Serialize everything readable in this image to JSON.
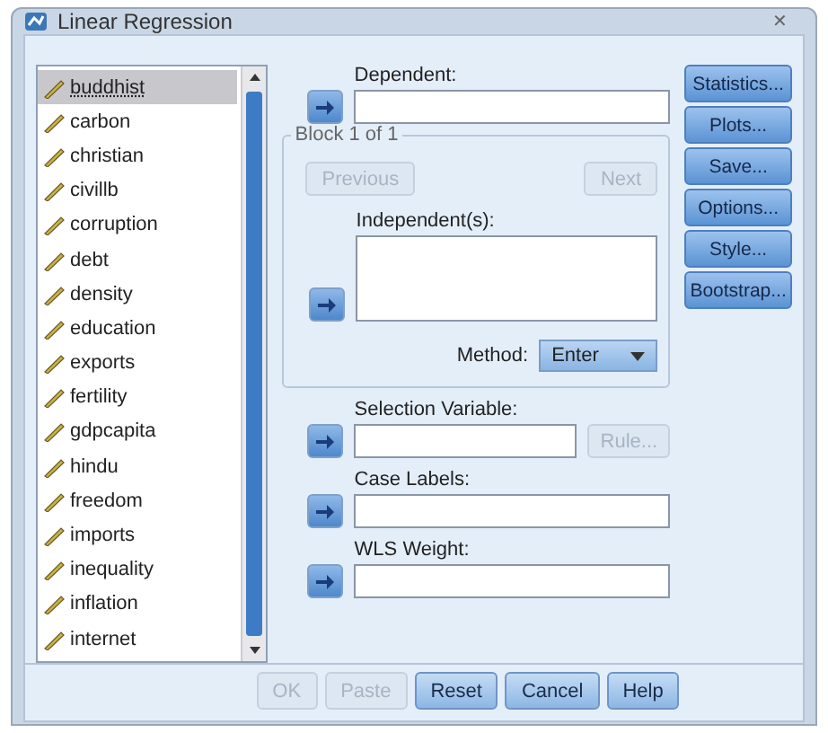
{
  "window": {
    "title": "Linear Regression",
    "close": "✕"
  },
  "variables": [
    {
      "name": "buddhist",
      "selected": true
    },
    {
      "name": "carbon",
      "selected": false
    },
    {
      "name": "christian",
      "selected": false
    },
    {
      "name": "civillb",
      "selected": false
    },
    {
      "name": "corruption",
      "selected": false
    },
    {
      "name": "debt",
      "selected": false
    },
    {
      "name": "density",
      "selected": false
    },
    {
      "name": "education",
      "selected": false
    },
    {
      "name": "exports",
      "selected": false
    },
    {
      "name": "fertility",
      "selected": false
    },
    {
      "name": "gdpcapita",
      "selected": false
    },
    {
      "name": "hindu",
      "selected": false
    },
    {
      "name": "freedom",
      "selected": false
    },
    {
      "name": "imports",
      "selected": false
    },
    {
      "name": "inequality",
      "selected": false
    },
    {
      "name": "inflation",
      "selected": false
    },
    {
      "name": "internet",
      "selected": false
    }
  ],
  "dependent": {
    "label": "Dependent:"
  },
  "block": {
    "title": "Block 1 of 1",
    "previous": {
      "label": "Previous",
      "disabled": true
    },
    "next": {
      "label": "Next",
      "disabled": true
    },
    "independents_label": "Independent(s):",
    "method_label": "Method:",
    "method_value": "Enter"
  },
  "selection": {
    "label": "Selection Variable:",
    "rule": {
      "label": "Rule...",
      "disabled": true
    }
  },
  "case_labels": {
    "label": "Case Labels:"
  },
  "wls": {
    "label": "WLS Weight:"
  },
  "side_buttons": [
    {
      "label": "Statistics...",
      "disabled": false
    },
    {
      "label": "Plots...",
      "disabled": false
    },
    {
      "label": "Save...",
      "disabled": false
    },
    {
      "label": "Options...",
      "disabled": false
    },
    {
      "label": "Style...",
      "disabled": false
    },
    {
      "label": "Bootstrap...",
      "disabled": false
    }
  ],
  "footer_buttons": [
    {
      "label": "OK",
      "disabled": true
    },
    {
      "label": "Paste",
      "disabled": true
    },
    {
      "label": "Reset",
      "disabled": false
    },
    {
      "label": "Cancel",
      "disabled": false
    },
    {
      "label": "Help",
      "disabled": false
    }
  ]
}
